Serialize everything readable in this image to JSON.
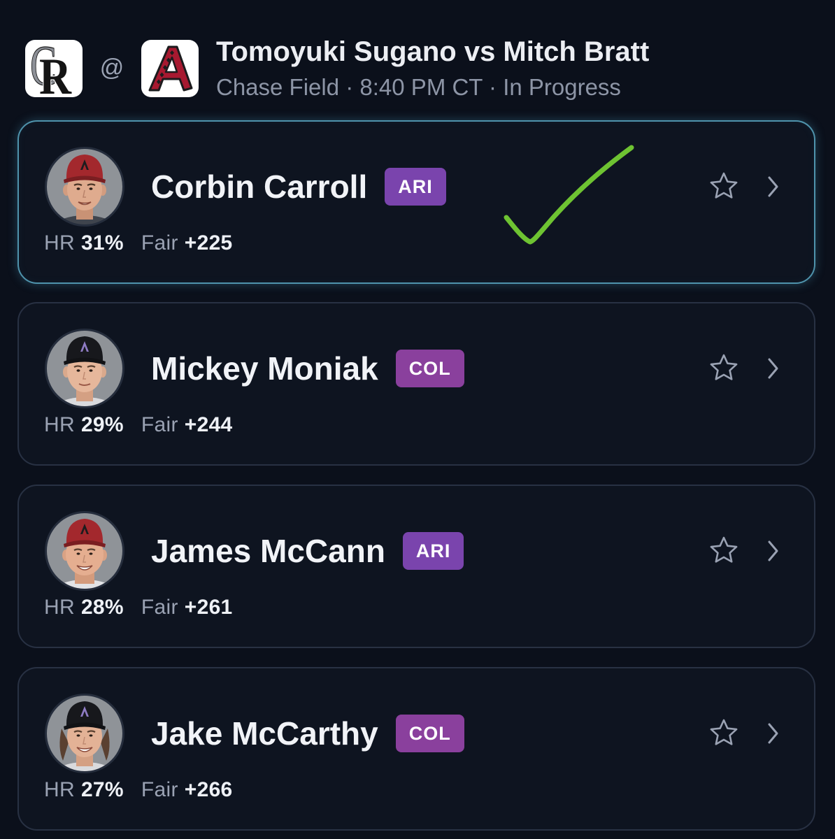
{
  "header": {
    "away_logo": {
      "icon": "rockies-logo-icon",
      "lettering": [
        "C",
        "R"
      ]
    },
    "at_symbol": "@",
    "home_logo": {
      "icon": "diamondbacks-logo-icon",
      "lettering": "A"
    },
    "title": "Tomoyuki Sugano vs Mitch Bratt",
    "subtitle": "Chase Field · 8:40 PM CT · In Progress"
  },
  "players": [
    {
      "name": "Corbin Carroll",
      "team": "ARI",
      "hr_label": "HR",
      "hr_value": "31%",
      "fair_label": "Fair",
      "fair_value": "+225",
      "highlighted": true,
      "avatar": "player-headshot",
      "badge_color": "#7a44ad",
      "cap_color": "#a3282d",
      "cap_logo_color": "#1c1c1e"
    },
    {
      "name": "Mickey Moniak",
      "team": "COL",
      "hr_label": "HR",
      "hr_value": "29%",
      "fair_label": "Fair",
      "fair_value": "+244",
      "highlighted": false,
      "avatar": "player-headshot",
      "badge_color": "#8a409d",
      "cap_color": "#17181c",
      "cap_logo_color": "#8f7cc4"
    },
    {
      "name": "James McCann",
      "team": "ARI",
      "hr_label": "HR",
      "hr_value": "28%",
      "fair_label": "Fair",
      "fair_value": "+261",
      "highlighted": false,
      "avatar": "player-headshot",
      "badge_color": "#7a44ad",
      "cap_color": "#a3282d",
      "cap_logo_color": "#1c1c1e"
    },
    {
      "name": "Jake McCarthy",
      "team": "COL",
      "hr_label": "HR",
      "hr_value": "27%",
      "fair_label": "Fair",
      "fair_value": "+266",
      "highlighted": false,
      "avatar": "player-headshot",
      "badge_color": "#8a409d",
      "cap_color": "#17181c",
      "cap_logo_color": "#8f7cc4"
    }
  ],
  "icons": {
    "favorite": "star-icon",
    "open_details": "chevron-right-icon"
  },
  "annotation": {
    "icon": "checkmark-icon",
    "color": "#6ec332"
  },
  "colors": {
    "page_background": "#0b101b",
    "card_border": "#283143",
    "highlight_border": "#4f93ac",
    "primary_text": "#eef1f6",
    "secondary_text": "#8d95a6"
  }
}
